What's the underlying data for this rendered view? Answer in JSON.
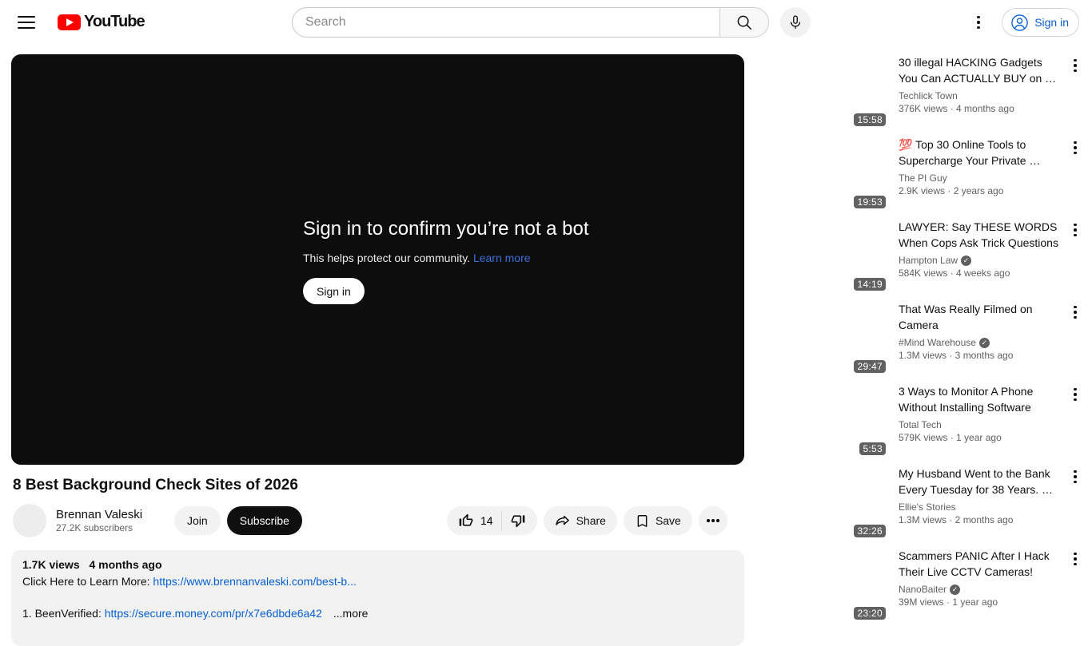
{
  "header": {
    "brand": "YouTube",
    "search_placeholder": "Search",
    "signin_label": "Sign in"
  },
  "player": {
    "title": "Sign in to confirm you’re not a bot",
    "subtitle": "This helps protect our community.",
    "learn_more_label": "Learn more",
    "signin_button_label": "Sign in"
  },
  "video": {
    "title": "8 Best Background Check Sites of 2026",
    "channel_name": "Brennan Valeski",
    "channel_subscribers": "27.2K subscribers",
    "join_label": "Join",
    "subscribe_label": "Subscribe",
    "like_count": "14",
    "share_label": "Share",
    "save_label": "Save"
  },
  "description": {
    "views": "1.7K views",
    "age": "4 months ago",
    "line1_prefix": "Click Here to Learn More: ",
    "line1_link": "https://www.brennanvaleski.com/best-b...",
    "line2_prefix": "1. BeenVerified: ",
    "line2_link": "https://secure.money.com/pr/x7e6dbde6a42",
    "more_label": "...more"
  },
  "sidebar": {
    "items": [
      {
        "duration": "15:58",
        "title": "30 illegal HACKING Gadgets You Can ACTUALLY BUY on …",
        "channel": "Techlick Town",
        "verified": false,
        "meta": "376K views · 4 months ago"
      },
      {
        "duration": "19:53",
        "title": "💯 Top 30 Online Tools to Supercharge Your Private …",
        "channel": "The PI Guy",
        "verified": false,
        "meta": "2.9K views · 2 years ago"
      },
      {
        "duration": "14:19",
        "title": "LAWYER: Say THESE WORDS When Cops Ask Trick Questions",
        "channel": "Hampton Law",
        "verified": true,
        "meta": "584K views · 4 weeks ago"
      },
      {
        "duration": "29:47",
        "title": "That Was Really Filmed on Camera",
        "channel": "#Mind Warehouse",
        "verified": true,
        "meta": "1.3M views · 3 months ago"
      },
      {
        "duration": "5:53",
        "title": "3 Ways to Monitor A Phone Without Installing Software",
        "channel": "Total Tech",
        "verified": false,
        "meta": "579K views · 1 year ago"
      },
      {
        "duration": "32:26",
        "title": "My Husband Went to the Bank Every Tuesday for 38 Years. …",
        "channel": "Ellie's Stories",
        "verified": false,
        "meta": "1.3M views · 2 months ago"
      },
      {
        "duration": "23:20",
        "title": "Scammers PANIC After I Hack Their Live CCTV Cameras!",
        "channel": "NanoBaiter",
        "verified": true,
        "meta": "39M views · 1 year ago"
      }
    ]
  },
  "colors": {
    "brand_red": "#ff0000",
    "link_blue": "#065fd4",
    "player_link_blue": "#3d6fd8",
    "text_primary": "#0f0f0f",
    "text_secondary": "#606060",
    "chip_gray": "#f2f2f2"
  }
}
